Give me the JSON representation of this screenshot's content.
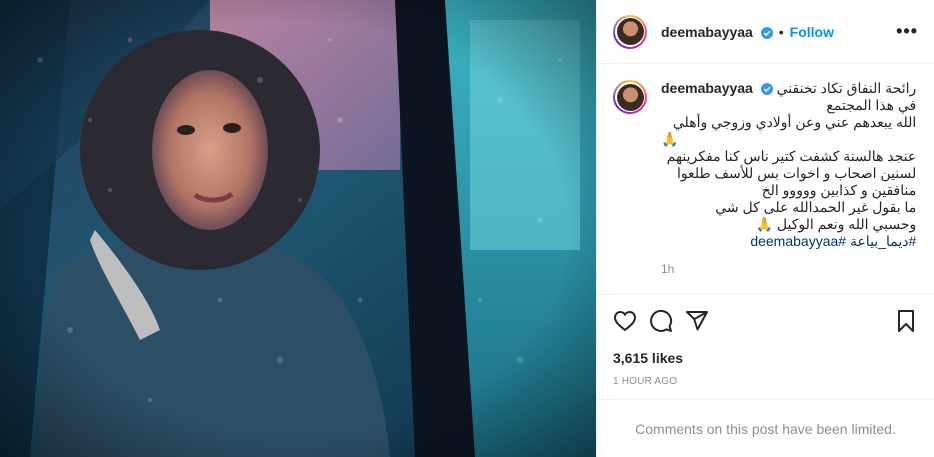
{
  "header": {
    "username": "deemabayyaa",
    "dot": "•",
    "follow_label": "Follow",
    "more_label": "•••"
  },
  "caption": {
    "username": "deemabayyaa",
    "lines": [
      "رائحة النفاق تكاد تخنقني",
      "في هذا المجتمع",
      "الله يبعدهم عني وعن أولادي وزوجي وأهلي",
      "🙏",
      "عنجد هالسنة كشفت كتير ناس كنا مفكرينهم",
      "لسنين اصحاب و اخوات بس للأسف طلعوا",
      "منافقين و كذابين ووووو الخ",
      "ما بقول غير الحمدالله على كل شي",
      "وحسبي الله ونعم الوكيل 🙏"
    ],
    "hashtags": "#ديما_بياعة #deemabayyaa",
    "time": "1h"
  },
  "stats": {
    "likes": "3,615 likes",
    "posted": "1 HOUR AGO"
  },
  "footer": {
    "limited": "Comments on this post have been limited."
  },
  "icons": {
    "verified_color": "#3897f0"
  }
}
